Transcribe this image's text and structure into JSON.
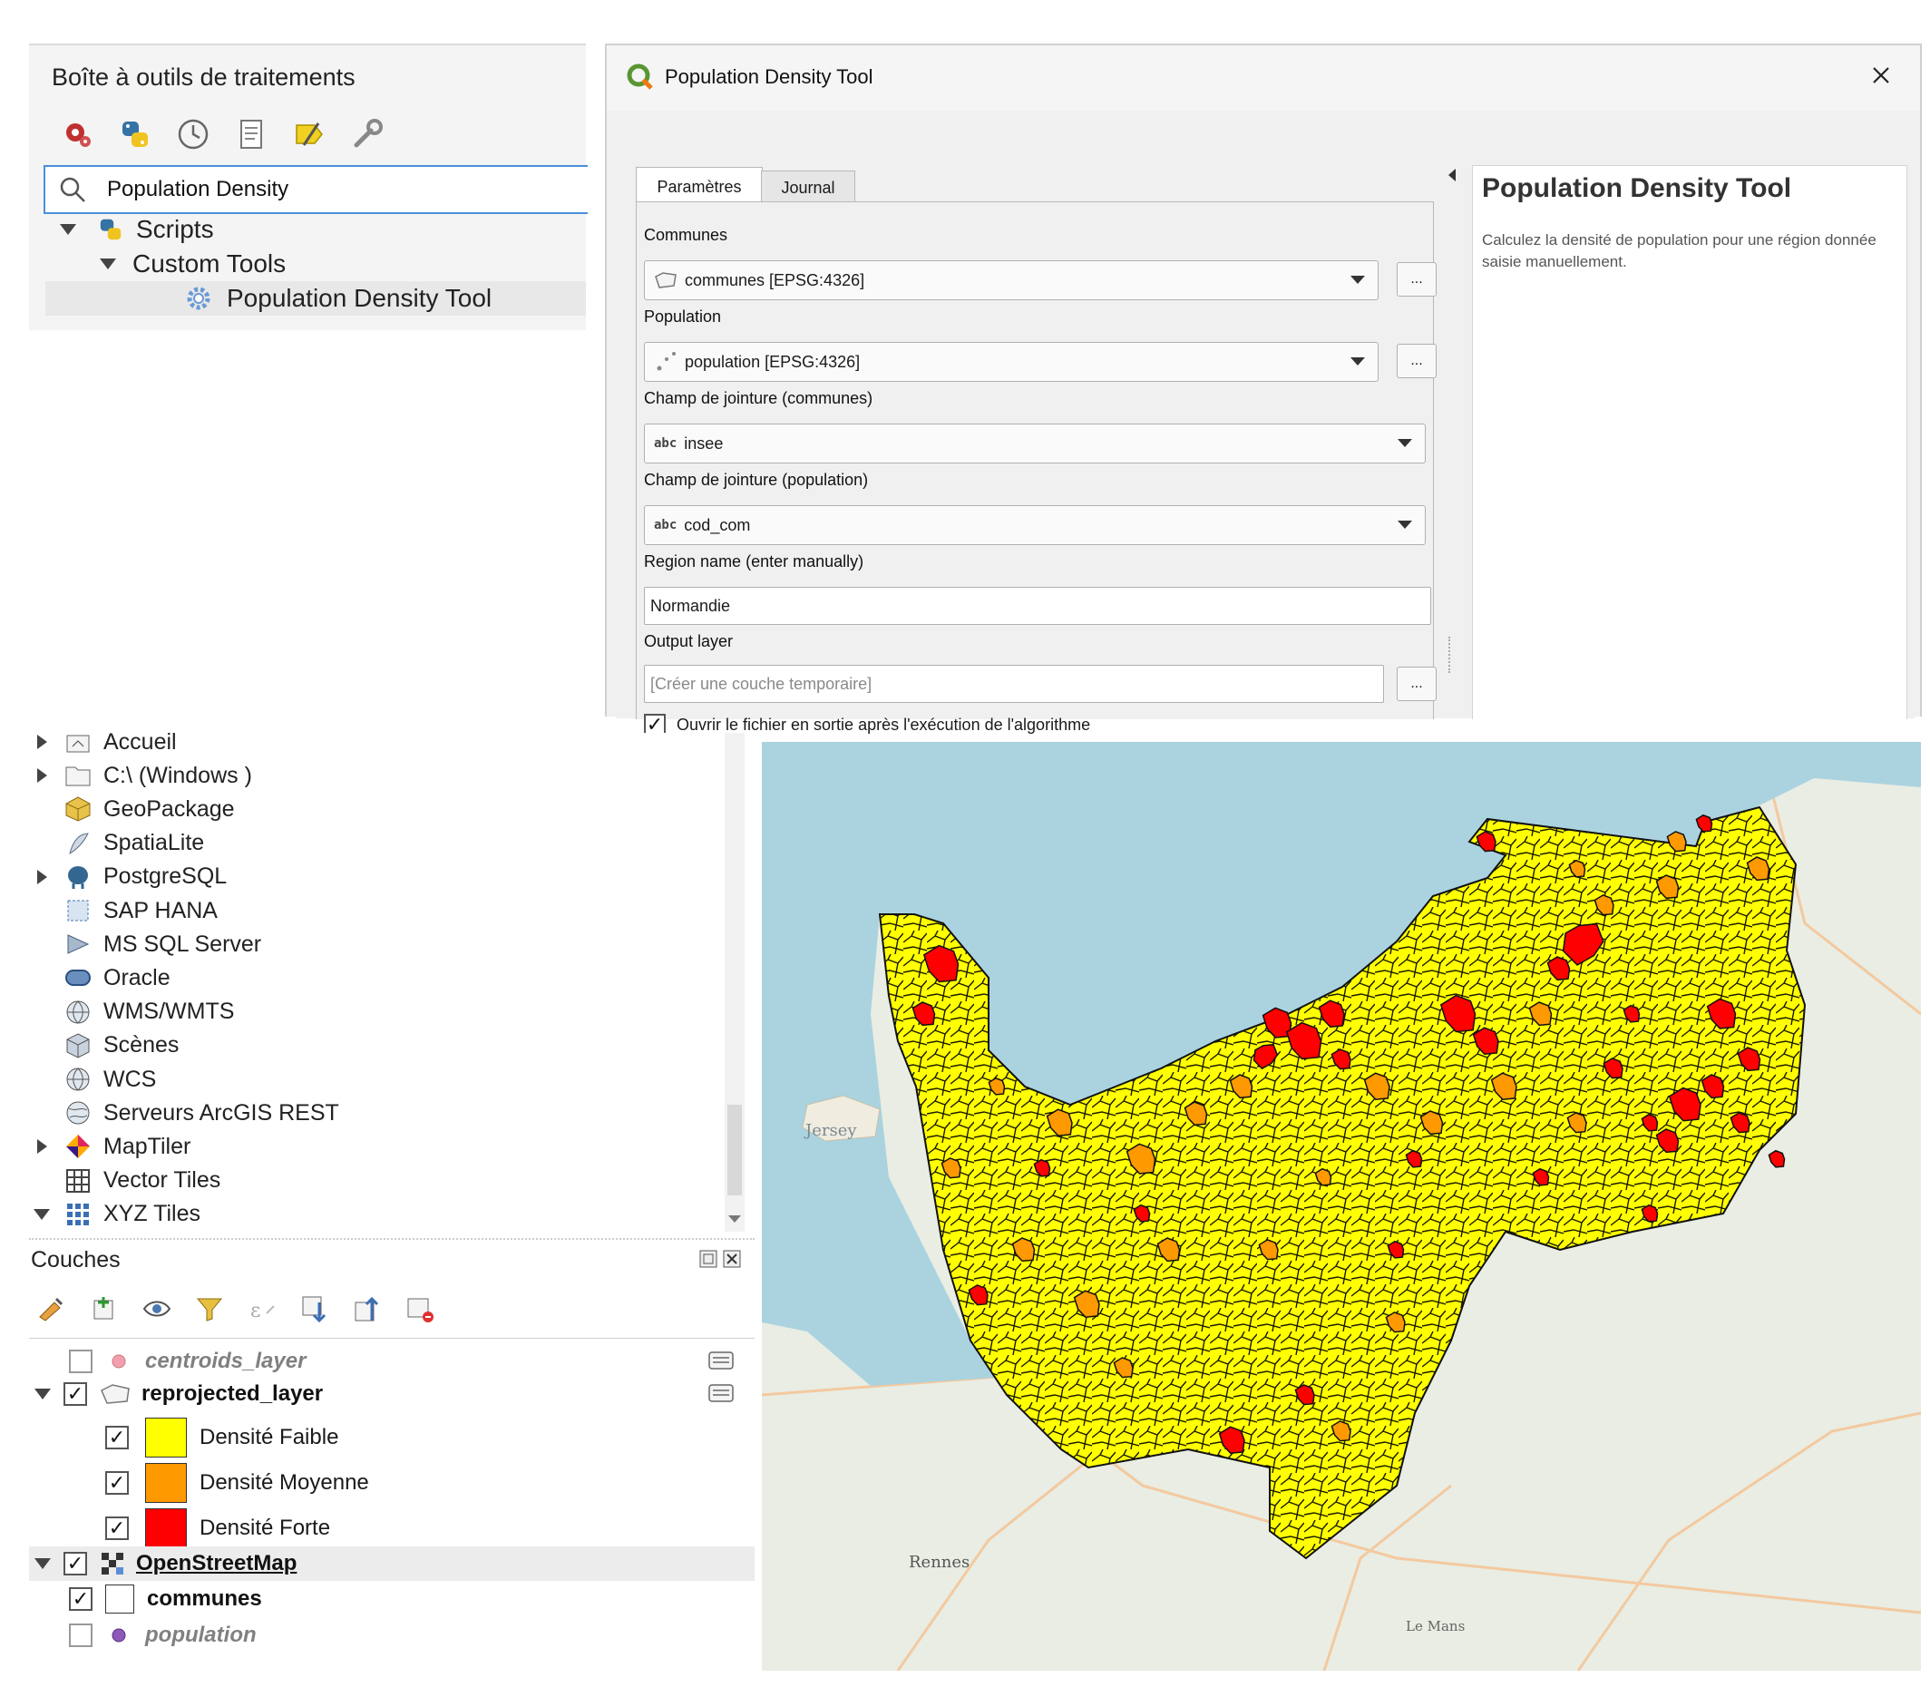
{
  "toolbox": {
    "title": "Boîte à outils de traitements",
    "tool_icons": [
      "run-model-icon",
      "python-icon",
      "history-icon",
      "results-icon",
      "edit-in-place-icon",
      "options-icon"
    ],
    "search_value": "Population Density",
    "tree": {
      "scripts_label": "Scripts",
      "custom_tools_label": "Custom Tools",
      "tool_label": "Population Density Tool"
    }
  },
  "dialog": {
    "title": "Population Density Tool",
    "tabs": [
      "Paramètres",
      "Journal"
    ],
    "fields": {
      "communes": {
        "label": "Communes",
        "value": "communes [EPSG:4326]"
      },
      "population": {
        "label": "Population",
        "value": "population [EPSG:4326]"
      },
      "join_communes": {
        "label": "Champ de jointure (communes)",
        "type_tag": "abc",
        "value": "insee"
      },
      "join_population": {
        "label": "Champ de jointure (population)",
        "type_tag": "abc",
        "value": "cod_com"
      },
      "region": {
        "label": "Region name (enter manually)",
        "value": "Normandie"
      },
      "output": {
        "label": "Output layer",
        "placeholder": "[Créer une couche temporaire]"
      },
      "open_output": {
        "label": "Ouvrir le fichier en sortie après l'exécution de l'algorithme",
        "checked": true
      }
    },
    "dots_label": "...",
    "help": {
      "title": "Population Density Tool",
      "text": "Calculez la densité de population pour une région donnée saisie manuellement."
    }
  },
  "browser": {
    "items": [
      {
        "label": "Accueil",
        "icon": "home-folder-icon",
        "expandable": true
      },
      {
        "label": "C:\\ (Windows )",
        "icon": "drive-folder-icon",
        "expandable": true
      },
      {
        "label": "GeoPackage",
        "icon": "geopackage-icon",
        "expandable": false
      },
      {
        "label": "SpatiaLite",
        "icon": "spatialite-icon",
        "expandable": false
      },
      {
        "label": "PostgreSQL",
        "icon": "postgresql-icon",
        "expandable": true
      },
      {
        "label": "SAP HANA",
        "icon": "sap-hana-icon",
        "expandable": false
      },
      {
        "label": "MS SQL Server",
        "icon": "mssql-icon",
        "expandable": false
      },
      {
        "label": "Oracle",
        "icon": "oracle-icon",
        "expandable": false
      },
      {
        "label": "WMS/WMTS",
        "icon": "wms-globe-icon",
        "expandable": false
      },
      {
        "label": "Scènes",
        "icon": "scenes-cube-icon",
        "expandable": false
      },
      {
        "label": "WCS",
        "icon": "wcs-globe-icon",
        "expandable": false
      },
      {
        "label": "Serveurs ArcGIS REST",
        "icon": "arcgis-globe-icon",
        "expandable": false
      },
      {
        "label": "MapTiler",
        "icon": "maptiler-icon",
        "expandable": true
      },
      {
        "label": "Vector Tiles",
        "icon": "vector-tiles-icon",
        "expandable": false
      },
      {
        "label": "XYZ Tiles",
        "icon": "xyz-tiles-icon",
        "expandable": "open"
      }
    ]
  },
  "layers": {
    "title": "Couches",
    "toolbar_icons": [
      "style-icon",
      "add-group-icon",
      "visibility-icon",
      "filter-legend-icon",
      "filter-expression-icon",
      "expand-all-icon",
      "collapse-all-icon",
      "remove-layer-icon"
    ],
    "items": {
      "centroids": {
        "label": "centroids_layer",
        "checked": false
      },
      "reprojected": {
        "label": "reprojected_layer",
        "checked": true
      },
      "classes": [
        {
          "label": "Densité Faible",
          "color": "#ffff00",
          "checked": true
        },
        {
          "label": "Densité Moyenne",
          "color": "#ff9900",
          "checked": true
        },
        {
          "label": "Densité Forte",
          "color": "#ff0000",
          "checked": true
        }
      ],
      "osm": {
        "label": "OpenStreetMap",
        "checked": true
      },
      "communes": {
        "label": "communes",
        "checked": true
      },
      "population": {
        "label": "population",
        "checked": false
      }
    }
  },
  "map": {
    "colors": {
      "sea": "#aad3df",
      "land": "#e9ede3",
      "faible": "#ffff00",
      "moyenne": "#ff9900",
      "forte": "#ff0000"
    },
    "labels": [
      "Jersey",
      "Rennes",
      "Le Mans"
    ]
  }
}
